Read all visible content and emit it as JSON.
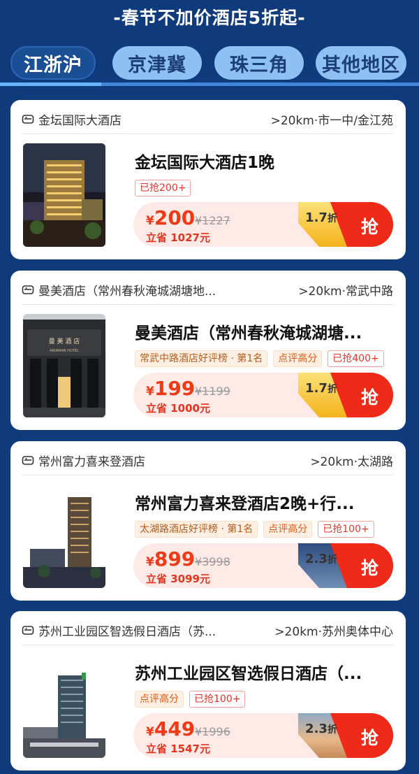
{
  "banner": {
    "title": "-春节不加价酒店5折起-"
  },
  "tabs": [
    {
      "label": "江浙沪",
      "active": true
    },
    {
      "label": "京津冀",
      "active": false
    },
    {
      "label": "珠三角",
      "active": false
    },
    {
      "label": "其他地区",
      "active": false
    }
  ],
  "colors": {
    "page_bg": "#0f3a7c",
    "price_red": "#f03a17",
    "grab_red": "#ef2a18",
    "discount_yellow": "#f7c722"
  },
  "cards": [
    {
      "hotel_name": "金坛国际大酒店",
      "location": ">20km·市一中/金江苑",
      "title": "金坛国际大酒店1晚",
      "tags": [
        {
          "kind": "grab",
          "text": "已抢200+"
        }
      ],
      "price_symbol": "¥",
      "price": "200",
      "original_price": "¥1227",
      "save_text": "立省 1027元",
      "discount": "1.7",
      "discount_unit": "折",
      "grab_label": "抢",
      "image_icon": "hotel-night-photo"
    },
    {
      "hotel_name": "曼美酒店（常州春秋淹城湖塘地...",
      "location": ">20km·常武中路",
      "title": "曼美酒店（常州春秋淹城湖塘...",
      "tags": [
        {
          "kind": "rank",
          "text": "常武中路酒店好评榜 · 第1名"
        },
        {
          "kind": "score",
          "text": "点评高分"
        },
        {
          "kind": "grab",
          "text": "已抢400+"
        }
      ],
      "price_symbol": "¥",
      "price": "199",
      "original_price": "¥1199",
      "save_text": "立省 1000元",
      "discount": "1.7",
      "discount_unit": "折",
      "grab_label": "抢",
      "image_icon": "hotel-entrance-photo",
      "image_sign": "曼 美 酒 店"
    },
    {
      "hotel_name": "常州富力喜来登酒店",
      "location": ">20km·太湖路",
      "title": "常州富力喜来登酒店2晚+行...",
      "tags": [
        {
          "kind": "rank",
          "text": "太湖路酒店好评榜 · 第1名"
        },
        {
          "kind": "score",
          "text": "点评高分"
        },
        {
          "kind": "grab",
          "text": "已抢100+"
        }
      ],
      "price_symbol": "¥",
      "price": "899",
      "original_price": "¥3998",
      "save_text": "立省 3099元",
      "discount": "2.3",
      "discount_unit": "折",
      "grab_label": "抢",
      "image_icon": "hotel-tower-photo"
    },
    {
      "hotel_name": "苏州工业园区智选假日酒店（苏...",
      "location": ">20km·苏州奥体中心",
      "title": "苏州工业园区智选假日酒店（...",
      "tags": [
        {
          "kind": "score",
          "text": "点评高分"
        },
        {
          "kind": "grab",
          "text": "已抢100+"
        }
      ],
      "price_symbol": "¥",
      "price": "449",
      "original_price": "¥1996",
      "save_text": "立省 1547元",
      "discount": "2.3",
      "discount_unit": "折",
      "grab_label": "抢",
      "image_icon": "hotel-sunset-photo"
    }
  ]
}
